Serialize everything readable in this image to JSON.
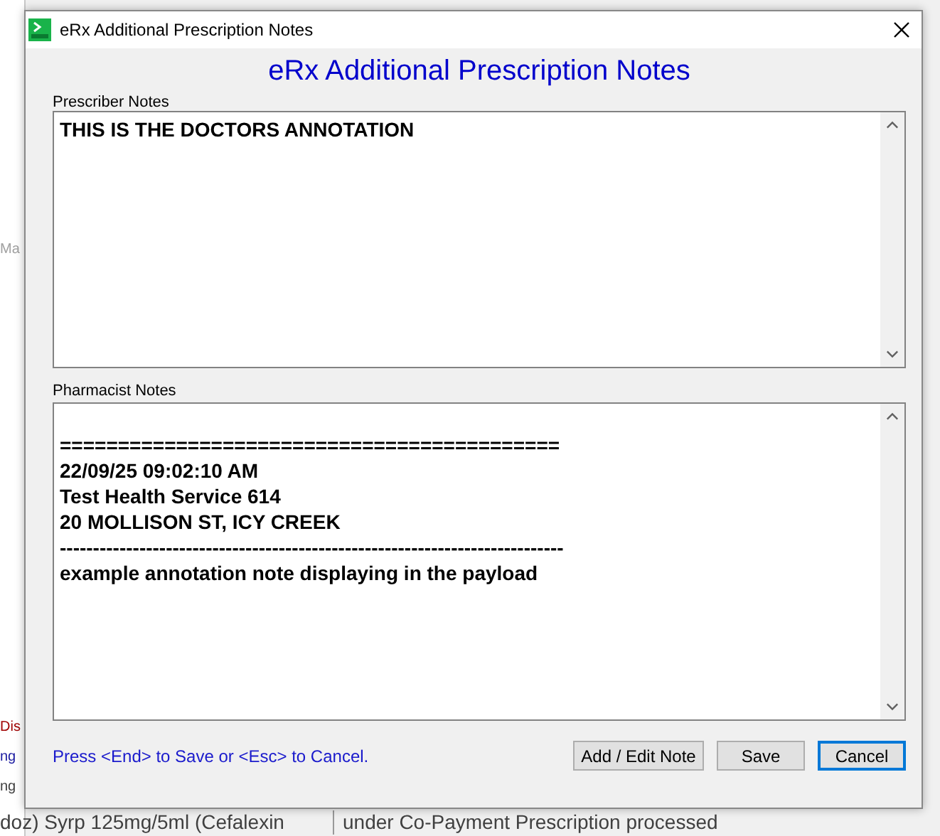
{
  "background_app": {
    "left_fragments": [
      {
        "text": "Ma",
        "color": "#a0a0a0"
      },
      {
        "text": "Dis",
        "color": "#a00000"
      },
      {
        "text": "ng",
        "color": "#1a1aa0"
      },
      {
        "text": "ng",
        "color": "#404040"
      }
    ],
    "bottom_row": [
      "doz) Syrp 125mg/5ml (Cefalexin",
      "under Co-Payment Prescription processed"
    ]
  },
  "window": {
    "title": "eRx Additional Prescription Notes",
    "heading": "eRx Additional Prescription Notes"
  },
  "prescriber_notes": {
    "label": "Prescriber Notes",
    "lines": [
      "THIS IS THE DOCTORS ANNOTATION"
    ]
  },
  "pharmacist_notes": {
    "label": "Pharmacist Notes",
    "lines": [
      "===========================================",
      "22/09/25 09:02:10 AM",
      "Test Health Service 614",
      "20 MOLLISON ST, ICY CREEK",
      "----------------------------------------------------------------------------",
      "example annotation note displaying in the payload"
    ]
  },
  "hint": "Press <End> to Save or <Esc> to Cancel.",
  "buttons": [
    {
      "label": "Add / Edit Note",
      "selected": false
    },
    {
      "label": "Save",
      "selected": false
    },
    {
      "label": "Cancel",
      "selected": true
    }
  ]
}
